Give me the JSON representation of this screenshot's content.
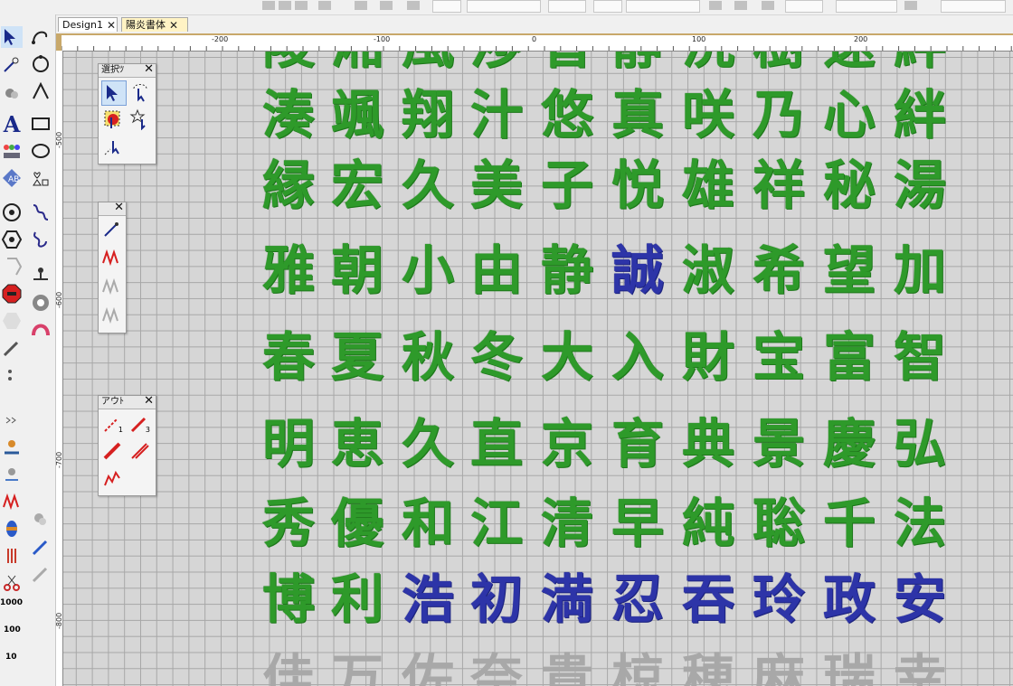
{
  "tabs": [
    {
      "label": "Design1",
      "close": "✕"
    },
    {
      "label": "陽炎書体",
      "close": "✕"
    }
  ],
  "rulers": {
    "top": [
      "-200",
      "-100",
      "0",
      "100",
      "200"
    ],
    "left": [
      "-500",
      "-600",
      "-700",
      "-800"
    ]
  },
  "palettes": {
    "select": {
      "title": "選択ﾂ",
      "close": "✕"
    },
    "stitch": {
      "title": "",
      "close": "✕"
    },
    "outline": {
      "title": "アウﾄ",
      "close": "✕"
    }
  },
  "left_toolbar": {
    "text_tool": "A",
    "zoom_labels": [
      "1000",
      "100",
      "10"
    ]
  },
  "outline_palette_labels": [
    "1",
    "3"
  ],
  "canvas": {
    "rows": [
      {
        "chars": [
          "陵",
          "湘",
          "風",
          "渉",
          "智",
          "静",
          "洗",
          "樹",
          "速",
          "絆"
        ],
        "colors": [
          "g",
          "g",
          "g",
          "g",
          "g",
          "g",
          "g",
          "g",
          "g",
          "g"
        ]
      },
      {
        "chars": [
          "湊",
          "颯",
          "翔",
          "汁",
          "悠",
          "真",
          "咲",
          "乃",
          "心",
          "絆"
        ],
        "colors": [
          "g",
          "g",
          "g",
          "g",
          "g",
          "g",
          "g",
          "g",
          "g",
          "g"
        ]
      },
      {
        "chars": [
          "縁",
          "宏",
          "久",
          "美",
          "子",
          "悦",
          "雄",
          "祥",
          "秘",
          "湯"
        ],
        "colors": [
          "g",
          "g",
          "g",
          "g",
          "g",
          "g",
          "g",
          "g",
          "g",
          "g"
        ]
      },
      {
        "chars": [
          "雅",
          "朝",
          "小",
          "由",
          "静",
          "誠",
          "淑",
          "希",
          "望",
          "加"
        ],
        "colors": [
          "g",
          "g",
          "g",
          "g",
          "g",
          "b",
          "g",
          "g",
          "g",
          "g"
        ]
      },
      {
        "chars": [
          "春",
          "夏",
          "秋",
          "冬",
          "大",
          "入",
          "財",
          "宝",
          "富",
          "智"
        ],
        "colors": [
          "g",
          "g",
          "g",
          "g",
          "g",
          "g",
          "g",
          "g",
          "g",
          "g"
        ]
      },
      {
        "chars": [
          "明",
          "恵",
          "久",
          "直",
          "京",
          "育",
          "典",
          "景",
          "慶",
          "弘"
        ],
        "colors": [
          "g",
          "g",
          "g",
          "g",
          "g",
          "g",
          "g",
          "g",
          "g",
          "g"
        ]
      },
      {
        "chars": [
          "秀",
          "優",
          "和",
          "江",
          "清",
          "早",
          "純",
          "聡",
          "千",
          "法"
        ],
        "colors": [
          "g",
          "g",
          "g",
          "g",
          "g",
          "g",
          "g",
          "g",
          "g",
          "g"
        ]
      },
      {
        "chars": [
          "博",
          "利",
          "浩",
          "初",
          "満",
          "忍",
          "吞",
          "玲",
          "政",
          "安"
        ],
        "colors": [
          "g",
          "g",
          "b",
          "b",
          "b",
          "b",
          "b",
          "b",
          "b",
          "b"
        ]
      },
      {
        "chars": [
          "佳",
          "万",
          "佐",
          "奈",
          "貴",
          "椋",
          "穂",
          "麻",
          "瑞",
          "幸"
        ],
        "colors": [
          "x",
          "x",
          "x",
          "x",
          "x",
          "x",
          "x",
          "x",
          "x",
          "x"
        ]
      }
    ]
  },
  "colors": {
    "green": "#2e9a2a",
    "blue": "#2d34a8",
    "gray": "#a8a8a8",
    "active_tab": "#fff3c4"
  }
}
